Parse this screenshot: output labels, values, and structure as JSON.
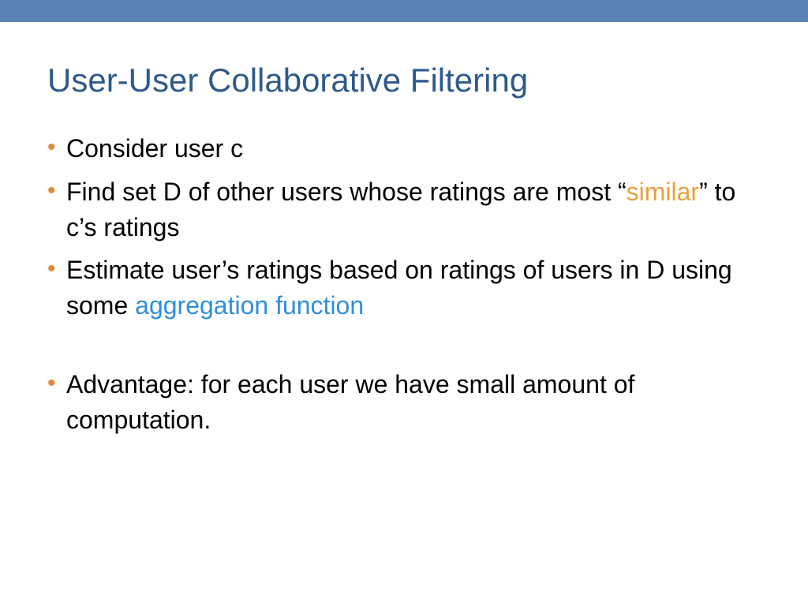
{
  "slide": {
    "title": "User-User Collaborative Filtering",
    "bullets": [
      {
        "t1": "Consider user c"
      },
      {
        "t1": "Find set D of other users whose ratings are most “",
        "hl1": "similar",
        "hl1_class": "hl-orange",
        "t2": "” to c’s ratings"
      },
      {
        "t1": "Estimate user’s ratings based on ratings of users in D using some ",
        "hl1": "aggregation function",
        "hl1_class": "hl-blue",
        "gap_after": true
      },
      {
        "t1": "Advantage: for each user we have small amount of computation."
      }
    ]
  },
  "colors": {
    "top_bar": "#5b82b4",
    "title": "#2e5a8b",
    "bullet_marker": "#e08b3b",
    "highlight_orange": "#e8a23d",
    "highlight_blue": "#2f8fd8"
  }
}
